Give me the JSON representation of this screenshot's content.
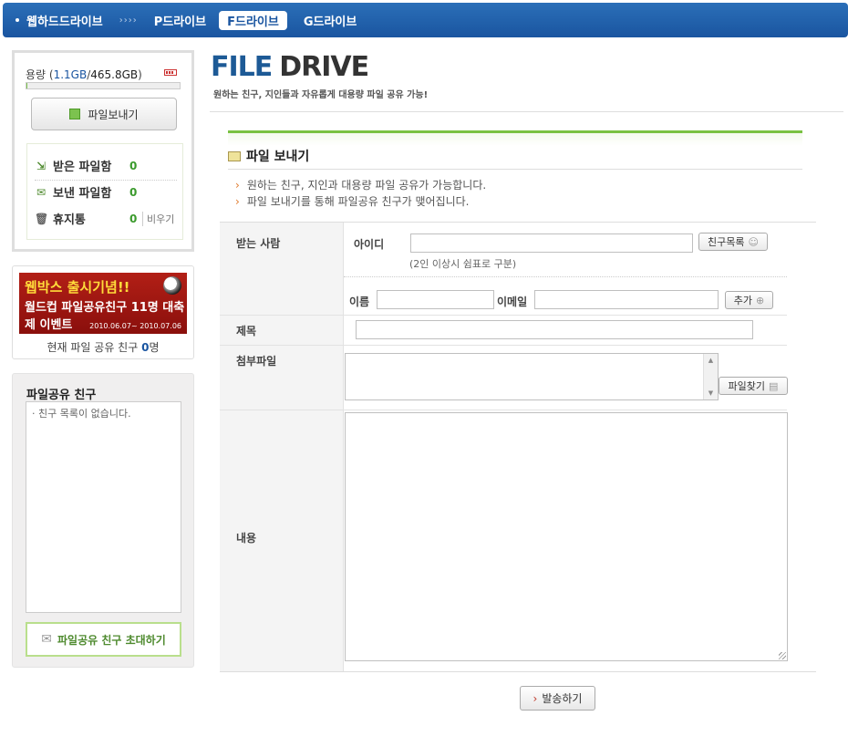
{
  "nav": {
    "items": [
      {
        "label": "웹하드드라이브"
      },
      {
        "label": "P드라이브"
      },
      {
        "label": "F드라이브"
      },
      {
        "label": "G드라이브"
      }
    ],
    "separator": "››››"
  },
  "storage": {
    "label": "용량 (",
    "used": "1.1GB",
    "slash": "/",
    "total": "465.8GB",
    "close": ")",
    "used_fraction": 0.0024,
    "send_button": "파일보내기"
  },
  "boxes": {
    "received": {
      "label": "받은 파일함",
      "count": "0"
    },
    "sent": {
      "label": "보낸 파일함",
      "count": "0"
    },
    "trash": {
      "label": "휴지통",
      "count": "0",
      "empty_label": "비우기"
    }
  },
  "banner": {
    "line1": "웹박스 출시기념!!",
    "line2": "월드컵 파일공유친구 11명 대축제 이벤트",
    "dates": "2010.06.07~ 2010.07.06",
    "share_prefix": "현재 파일 공유 친구 ",
    "share_count": "0",
    "share_suffix": "명"
  },
  "friends": {
    "title": "파일공유 친구",
    "empty": "· 친구 목록이 없습니다.",
    "invite_button": "파일공유 친구 초대하기"
  },
  "header": {
    "logo_file": "FILE",
    "logo_drive": "DRIVE",
    "tagline": "원하는 친구, 지인들과 자유롭게 대용량 파일 공유 가능!"
  },
  "section": {
    "title": "파일 보내기",
    "notes": [
      "원하는 친구, 지인과 대용량 파일 공유가 가능합니다.",
      "파일 보내기를 통해 파일공유 친구가 맺어집니다."
    ]
  },
  "form": {
    "recipient_label": "받는 사람",
    "id_label": "아이디",
    "id_value": "",
    "friend_list_button": "친구목록",
    "id_hint": "(2인 이상시 쉼표로 구분)",
    "name_label": "이름",
    "name_value": "",
    "email_label": "이메일",
    "email_value": "",
    "add_button": "추가",
    "subject_label": "제목",
    "subject_value": "",
    "attach_label": "첨부파일",
    "find_file_button": "파일찾기",
    "content_label": "내용",
    "content_value": "",
    "submit_button": "발송하기"
  }
}
